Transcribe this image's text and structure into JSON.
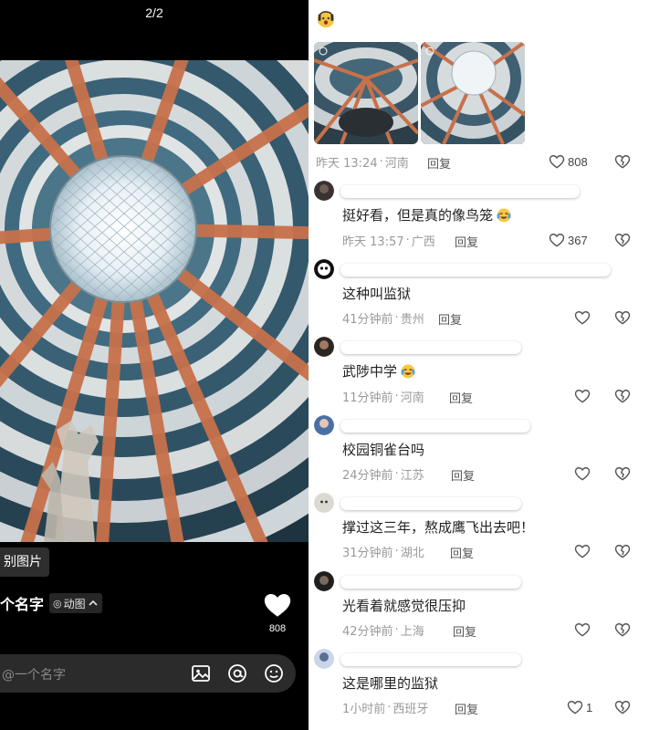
{
  "viewer": {
    "page_indicator": "2/2",
    "recognize_label": "别图片",
    "title": "个名字",
    "gif_label": "动图",
    "gif_dot": "◎",
    "like_count": "808",
    "input_placeholder": "@一个名字"
  },
  "icons": {
    "top_emoji": "shocked-emoji-icon",
    "heart": "heart-icon",
    "dislike": "broken-heart-icon",
    "image": "image-icon",
    "at": "at-icon",
    "emoji": "emoji-icon"
  },
  "colors": {
    "accent_pink": "#e44c6b",
    "meta_gray": "#9a9a9a"
  },
  "first_comment": {
    "time": "昨天 13:24",
    "location": "河南",
    "reply": "回复",
    "likes": "808"
  },
  "comments": [
    {
      "text": "挺好看，但是真的像鸟笼",
      "emoji": "crying-laughing-emoji-icon",
      "time": "昨天 13:57",
      "location": "广西",
      "reply": "回复",
      "likes": "367"
    },
    {
      "text": "这种叫监狱",
      "time": "41分钟前",
      "location": "贵州",
      "reply": "回复",
      "likes": ""
    },
    {
      "text": "武陟中学",
      "emoji": "crying-laughing-emoji-icon",
      "time": "11分钟前",
      "location": "河南",
      "reply": "回复",
      "likes": ""
    },
    {
      "text": "校园铜雀台吗",
      "time": "24分钟前",
      "location": "江苏",
      "reply": "回复",
      "likes": ""
    },
    {
      "text": "撑过这三年，熬成鹰飞出去吧！",
      "time": "31分钟前",
      "location": "湖北",
      "reply": "回复",
      "likes": ""
    },
    {
      "text": "光看着就感觉很压抑",
      "time": "42分钟前",
      "location": "上海",
      "reply": "回复",
      "likes": ""
    },
    {
      "text": "这是哪里的监狱",
      "time": "1小时前",
      "location": "西班牙",
      "reply": "回复",
      "likes": "1"
    }
  ]
}
